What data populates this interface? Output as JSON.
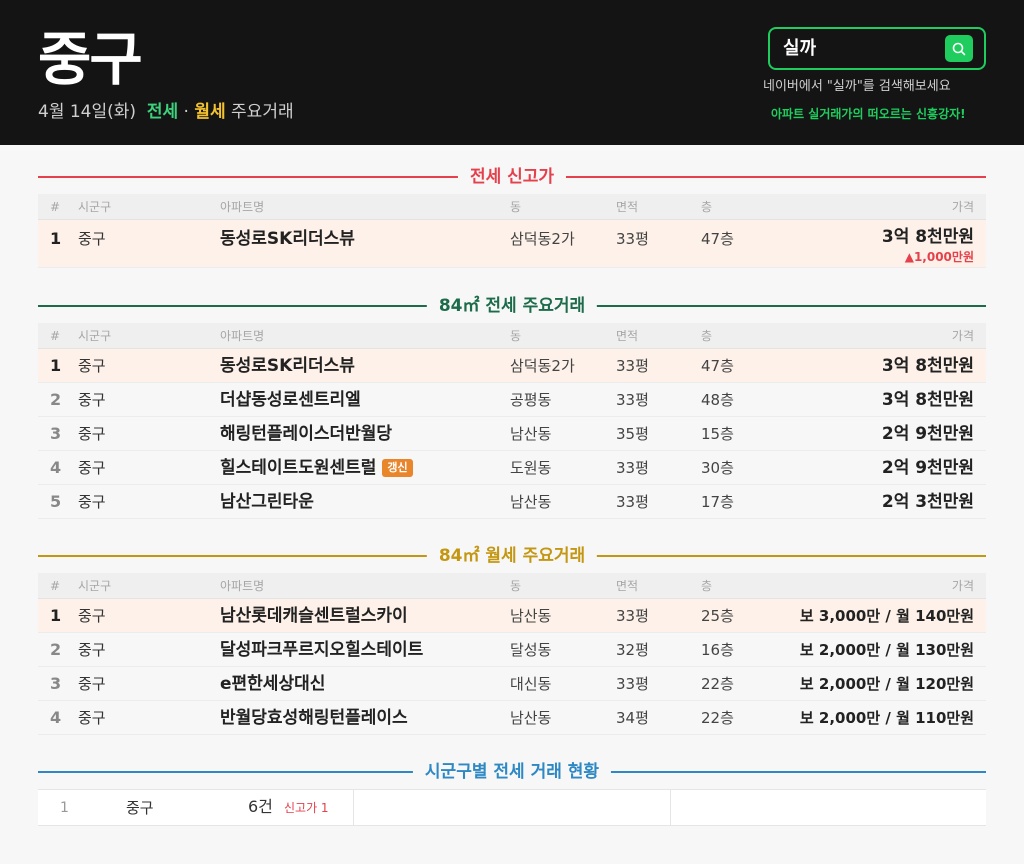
{
  "header": {
    "region": "중구",
    "date": "4월 14일(화)",
    "jeonse_label": "전세",
    "dot": "·",
    "wolse_label": "월세",
    "suffix": "주요거래",
    "search_text": "실까",
    "search_hint": "네이버에서 \"실까\"를 검색해보세요",
    "slogan": "아파트 실거래가의 떠오르는 신흥강자!"
  },
  "columns": {
    "no": "#",
    "sigungu": "시군구",
    "apt": "아파트명",
    "dong": "동",
    "area": "면적",
    "floor": "층",
    "price": "가격"
  },
  "sections": {
    "record": "전세 신고가",
    "jeonse84": "84㎡ 전세 주요거래",
    "wolse84": "84㎡ 월세 주요거래",
    "status": "시군구별 전세 거래 현황"
  },
  "record_rows": [
    {
      "no": "1",
      "sigungu": "중구",
      "apt": "동성로SK리더스뷰",
      "dong": "삼덕동2가",
      "area": "33평",
      "floor": "47층",
      "price": "3억 8천만원",
      "change": "▲1,000만원"
    }
  ],
  "jeonse_rows": [
    {
      "no": "1",
      "sigungu": "중구",
      "apt": "동성로SK리더스뷰",
      "dong": "삼덕동2가",
      "area": "33평",
      "floor": "47층",
      "price": "3억 8천만원"
    },
    {
      "no": "2",
      "sigungu": "중구",
      "apt": "더샵동성로센트리엘",
      "dong": "공평동",
      "area": "33평",
      "floor": "48층",
      "price": "3억 8천만원"
    },
    {
      "no": "3",
      "sigungu": "중구",
      "apt": "해링턴플레이스더반월당",
      "dong": "남산동",
      "area": "35평",
      "floor": "15층",
      "price": "2억 9천만원"
    },
    {
      "no": "4",
      "sigungu": "중구",
      "apt": "힐스테이트도원센트럴",
      "badge": "갱신",
      "dong": "도원동",
      "area": "33평",
      "floor": "30층",
      "price": "2억 9천만원"
    },
    {
      "no": "5",
      "sigungu": "중구",
      "apt": "남산그린타운",
      "dong": "남산동",
      "area": "33평",
      "floor": "17층",
      "price": "2억 3천만원"
    }
  ],
  "wolse_rows": [
    {
      "no": "1",
      "sigungu": "중구",
      "apt": "남산롯데캐슬센트럴스카이",
      "dong": "남산동",
      "area": "33평",
      "floor": "25층",
      "price": "보 3,000만 / 월 140만원"
    },
    {
      "no": "2",
      "sigungu": "중구",
      "apt": "달성파크푸르지오힐스테이트",
      "dong": "달성동",
      "area": "32평",
      "floor": "16층",
      "price": "보 2,000만 / 월 130만원"
    },
    {
      "no": "3",
      "sigungu": "중구",
      "apt": "e편한세상대신",
      "dong": "대신동",
      "area": "33평",
      "floor": "22층",
      "price": "보 2,000만 / 월 120만원"
    },
    {
      "no": "4",
      "sigungu": "중구",
      "apt": "반월당효성해링턴플레이스",
      "dong": "남산동",
      "area": "34평",
      "floor": "22층",
      "price": "보 2,000만 / 월 110만원"
    }
  ],
  "summary": {
    "no": "1",
    "name": "중구",
    "count": "6건",
    "high": "신고가 1"
  },
  "colors": {
    "jeonse": "#3fd27d",
    "wolse": "#f2c230",
    "red": "#e4414c",
    "green": "#1d6b4a",
    "gold": "#c49712",
    "blue": "#2d88c4",
    "naver": "#1fcc5e"
  }
}
